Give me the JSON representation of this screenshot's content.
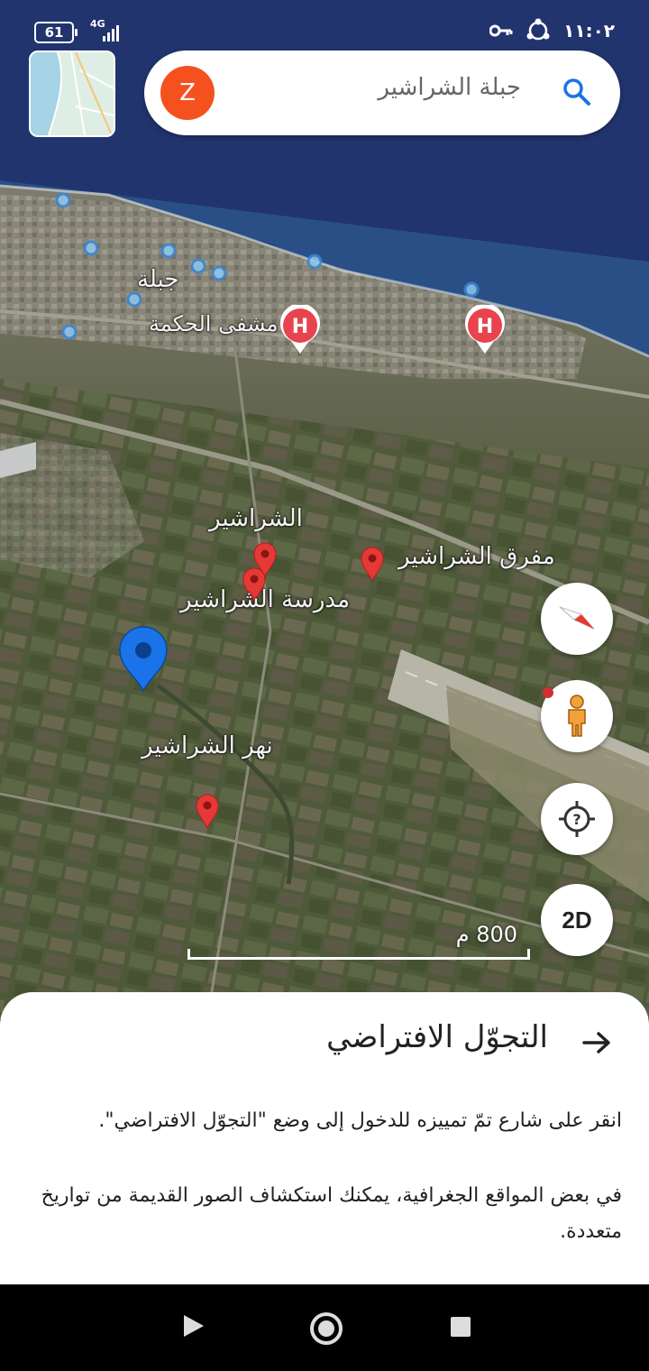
{
  "status": {
    "battery": "61",
    "network": "4G",
    "time": "١١:٠٢"
  },
  "search": {
    "avatar_letter": "Z",
    "query": "جبلة الشراشير"
  },
  "map_labels": {
    "jableh": "جبلة",
    "hikma_hospital": "مشفى الحكمة",
    "shrashir": "الشراشير",
    "shrashir_junction": "مفرق الشراشير",
    "shrashir_school": "مدرسة الشراشير",
    "shrashir_river": "نهر الشراشير"
  },
  "controls": {
    "view_mode": "2D"
  },
  "scale": {
    "label": "800 م"
  },
  "sheet": {
    "title": "التجوّل الافتراضي",
    "line1": "انقر على شارع تمّ تمييزه للدخول إلى وضع \"التجوّل الافتراضي\".",
    "line2": "في بعض المواقع الجغرافية، يمكنك استكشاف الصور القديمة من تواريخ متعددة."
  },
  "colors": {
    "accent_blue": "#1a73e8",
    "pin_red": "#e53935",
    "avatar_orange": "#f4511e"
  }
}
